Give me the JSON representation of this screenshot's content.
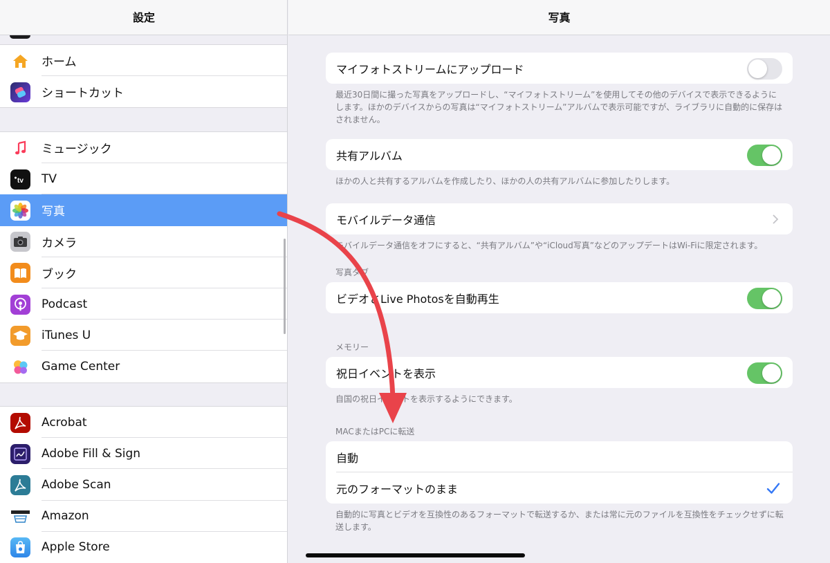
{
  "sidebar": {
    "title": "設定",
    "groups": [
      {
        "items": [
          {
            "label": "ホーム",
            "icon": "home-icon"
          },
          {
            "label": "ショートカット",
            "icon": "shortcuts-icon"
          }
        ]
      },
      {
        "items": [
          {
            "label": "ミュージック",
            "icon": "music-icon"
          },
          {
            "label": "TV",
            "icon": "tv-icon"
          },
          {
            "label": "写真",
            "icon": "photos-icon",
            "selected": true
          },
          {
            "label": "カメラ",
            "icon": "camera-icon"
          },
          {
            "label": "ブック",
            "icon": "books-icon"
          },
          {
            "label": "Podcast",
            "icon": "podcast-icon"
          },
          {
            "label": "iTunes U",
            "icon": "itunes-u-icon"
          },
          {
            "label": "Game Center",
            "icon": "game-center-icon"
          }
        ]
      },
      {
        "items": [
          {
            "label": "Acrobat",
            "icon": "acrobat-icon"
          },
          {
            "label": "Adobe Fill & Sign",
            "icon": "adobe-fill-sign-icon"
          },
          {
            "label": "Adobe Scan",
            "icon": "adobe-scan-icon"
          },
          {
            "label": "Amazon",
            "icon": "amazon-icon"
          },
          {
            "label": "Apple Store",
            "icon": "apple-store-icon"
          }
        ]
      }
    ]
  },
  "detail": {
    "title": "写真",
    "my_photo_stream": {
      "label": "マイフォトストリームにアップロード",
      "enabled": false,
      "note": "最近30日間に撮った写真をアップロードし、“マイフォトストリーム”を使用してその他のデバイスで表示できるようにします。ほかのデバイスからの写真は“マイフォトストリーム”アルバムで表示可能ですが、ライブラリに自動的に保存はされません。"
    },
    "shared_albums": {
      "label": "共有アルバム",
      "enabled": true,
      "note": "ほかの人と共有するアルバムを作成したり、ほかの人の共有アルバムに参加したりします。"
    },
    "cellular": {
      "label": "モバイルデータ通信",
      "note": "モバイルデータ通信をオフにすると、“共有アルバム”や“iCloud写真”などのアップデートはWi-Fiに限定されます。"
    },
    "photos_tab": {
      "section": "写真タブ",
      "autoplay_label": "ビデオとLive Photosを自動再生",
      "autoplay_enabled": true
    },
    "memories": {
      "section": "メモリー",
      "holiday_label": "祝日イベントを表示",
      "holiday_enabled": true,
      "note": "自国の祝日イベントを表示するようにできます。"
    },
    "transfer": {
      "section": "MACまたはPCに転送",
      "options": [
        {
          "label": "自動",
          "selected": false
        },
        {
          "label": "元のフォーマットのまま",
          "selected": true
        }
      ],
      "note": "自動的に写真とビデオを互換性のあるフォーマットで転送するか、または常に元のファイルを互換性をチェックせずに転送します。"
    }
  },
  "colors": {
    "accent": "#5b9cf6",
    "toggle_on": "#65c466",
    "annotation_arrow": "#e9434a",
    "checkmark": "#3478f6"
  }
}
